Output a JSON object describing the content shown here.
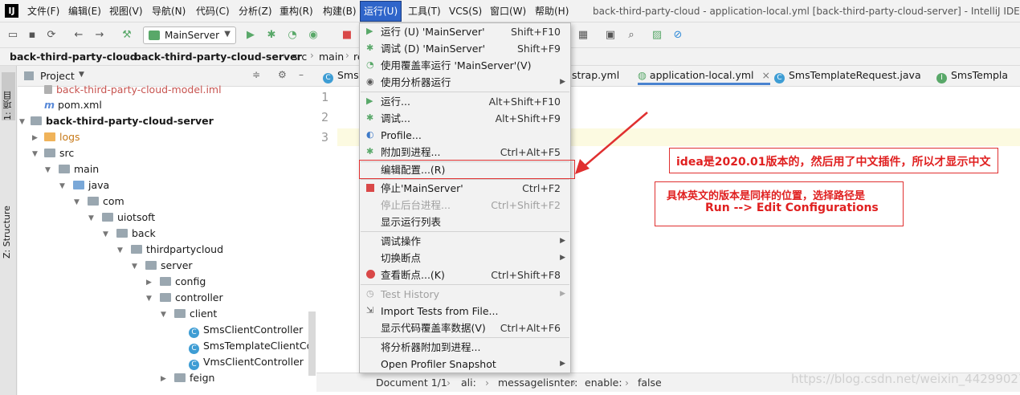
{
  "window_title": "back-third-party-cloud - application-local.yml [back-third-party-cloud-server] - IntelliJ IDEA",
  "menubar": [
    "文件(F)",
    "编辑(E)",
    "视图(V)",
    "导航(N)",
    "代码(C)",
    "分析(Z)",
    "重构(R)",
    "构建(B)",
    "运行(U)",
    "工具(T)",
    "VCS(S)",
    "窗口(W)",
    "帮助(H)"
  ],
  "run_config": "MainServer",
  "breadcrumb": [
    "back-third-party-cloud",
    "back-third-party-cloud-server",
    "src",
    "main",
    "re"
  ],
  "side_tabs": {
    "project": "1: 项目",
    "structure": "Z: Structure"
  },
  "project_panel": {
    "title": "Project",
    "tree": [
      "back-third-party-cloud-model.iml",
      "pom.xml",
      "back-third-party-cloud-server",
      "logs",
      "src",
      "main",
      "java",
      "com",
      "uiotsoft",
      "back",
      "thirdpartycloud",
      "server",
      "config",
      "controller",
      "client",
      "SmsClientController",
      "SmsTemplateClientContr",
      "VmsClientController",
      "feign"
    ]
  },
  "editor_tabs": [
    "Sms",
    "strap.yml",
    "application-local.yml",
    "SmsTemplateRequest.java",
    "SmsTempla"
  ],
  "line_numbers": [
    "1",
    "2",
    "3"
  ],
  "run_menu": {
    "items": [
      {
        "label": "运行 (U) 'MainServer'",
        "shortcut": "Shift+F10"
      },
      {
        "label": "调试 (D) 'MainServer'",
        "shortcut": "Shift+F9"
      },
      {
        "label": "使用覆盖率运行 'MainServer'(V)",
        "shortcut": ""
      },
      {
        "label": "使用分析器运行",
        "shortcut": ""
      },
      {
        "label": "运行...",
        "shortcut": "Alt+Shift+F10"
      },
      {
        "label": "调试...",
        "shortcut": "Alt+Shift+F9"
      },
      {
        "label": "Profile...",
        "shortcut": ""
      },
      {
        "label": "附加到进程...",
        "shortcut": "Ctrl+Alt+F5"
      },
      {
        "label": "编辑配置...(R)",
        "shortcut": ""
      },
      {
        "label": "停止'MainServer'",
        "shortcut": "Ctrl+F2"
      },
      {
        "label": "停止后台进程...",
        "shortcut": "Ctrl+Shift+F2"
      },
      {
        "label": "显示运行列表",
        "shortcut": ""
      },
      {
        "label": "调试操作",
        "shortcut": ""
      },
      {
        "label": "切换断点",
        "shortcut": ""
      },
      {
        "label": "查看断点...(K)",
        "shortcut": "Ctrl+Shift+F8"
      },
      {
        "label": "Test History",
        "shortcut": ""
      },
      {
        "label": "Import Tests from File...",
        "shortcut": ""
      },
      {
        "label": "显示代码覆盖率数据(V)",
        "shortcut": "Ctrl+Alt+F6"
      },
      {
        "label": "将分析器附加到进程...",
        "shortcut": ""
      },
      {
        "label": "Open Profiler Snapshot",
        "shortcut": ""
      }
    ]
  },
  "annotations": {
    "note1": "idea是2020.01版本的，然后用了中文插件，所以才显示中文",
    "note2_line1": "具体英文的版本是同样的位置，选择路径是",
    "note2_line2": "Run --> Edit Configurations"
  },
  "statusbar": [
    "Document 1/1",
    "ali:",
    "messagelisnter:",
    "enable:",
    "false"
  ],
  "watermark": "https://blog.csdn.net/weixin_44299027",
  "colors": {
    "accent": "#2f65ca",
    "annotation_red": "#e02020",
    "run_green": "#59a869",
    "stop_red": "#d94848"
  }
}
